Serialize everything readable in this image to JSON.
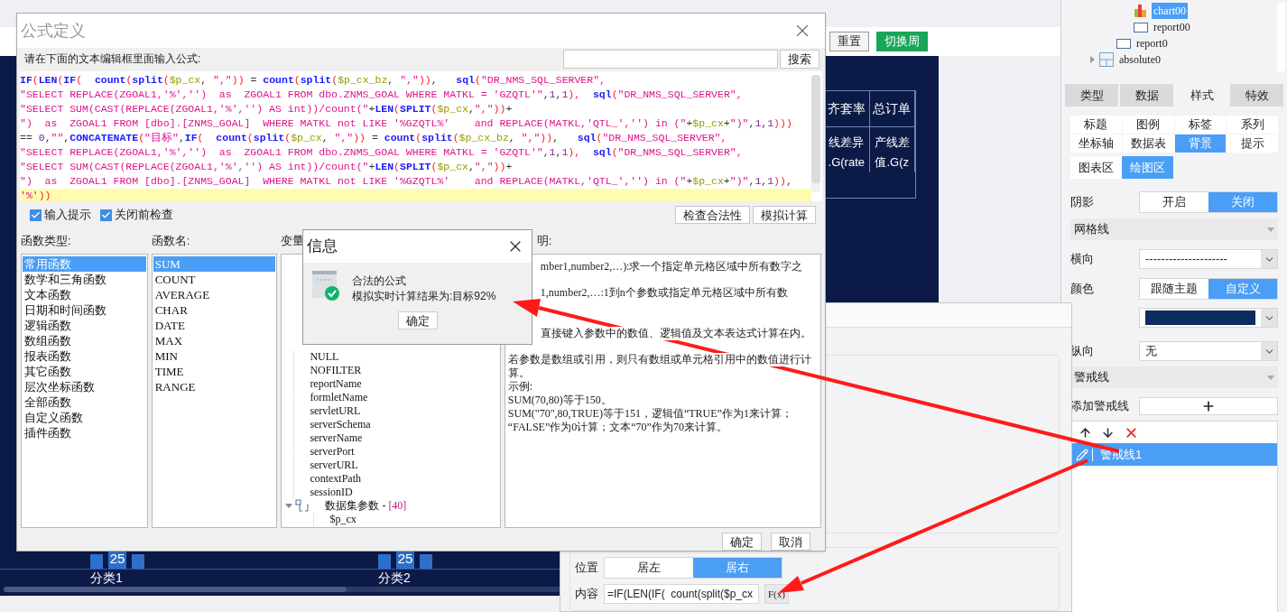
{
  "dashboard": {
    "buttons": [
      {
        "label": "重置",
        "kind": "plain"
      },
      {
        "label": "切换周",
        "kind": "primary"
      }
    ],
    "table": {
      "columns": [
        "齐套率",
        "总订单"
      ],
      "cells": [
        [
          "线差异",
          ".G(rate"
        ],
        [
          "产线差",
          "值.G(z"
        ]
      ]
    },
    "categories": [
      {
        "label": "分类1",
        "value_label": "25"
      },
      {
        "label": "分类2",
        "value_label": "25"
      }
    ]
  },
  "series_dialog": {
    "position": {
      "label": "位置",
      "options": [
        {
          "label": "居左",
          "selected": false
        },
        {
          "label": "居右",
          "selected": true
        }
      ]
    },
    "content": {
      "label": "内容",
      "value": "=IF(LEN(IF(  count(split($p_cx",
      "button": "F(x)"
    }
  },
  "right_panel": {
    "tree": [
      {
        "children": [
          {
            "children": [
              {
                "label": "chart00",
                "kind": "chart",
                "selected": true
              },
              {
                "label": "report00",
                "kind": "report",
                "selected": false
              }
            ]
          },
          {
            "label": "report0",
            "kind": "report",
            "selected": false
          }
        ]
      },
      {
        "label": "absolute0",
        "kind": "layout",
        "selected": false,
        "expanded": false
      }
    ],
    "tabs": [
      {
        "label": "类型",
        "selected": false
      },
      {
        "label": "数据",
        "selected": false
      },
      {
        "label": "样式",
        "selected": true
      },
      {
        "label": "特效",
        "selected": false
      }
    ],
    "sub_tabs": [
      {
        "label": "标题",
        "selected": false
      },
      {
        "label": "图例",
        "selected": false
      },
      {
        "label": "标签",
        "selected": false
      },
      {
        "label": "系列",
        "selected": false
      },
      {
        "label": "坐标轴",
        "selected": false
      },
      {
        "label": "数据表",
        "selected": false
      },
      {
        "label": "背景",
        "selected": true
      },
      {
        "label": "提示",
        "selected": false
      }
    ],
    "area_tabs": [
      {
        "label": "图表区",
        "selected": false
      },
      {
        "label": "绘图区",
        "selected": true
      }
    ],
    "shadow": {
      "label": "阴影",
      "options": [
        {
          "label": "开启",
          "selected": false
        },
        {
          "label": "关闭",
          "selected": true
        }
      ]
    },
    "gridlines": {
      "title": "网格线",
      "expanded": true,
      "horizontal": {
        "label": "横向",
        "value": "---------------------"
      },
      "color": {
        "label": "颜色",
        "options": [
          {
            "label": "跟随主题",
            "selected": false
          },
          {
            "label": "自定义",
            "selected": true
          }
        ]
      },
      "color_value": {
        "color": "#0b2c5f"
      },
      "vertical": {
        "label": "纵向",
        "value": "无"
      }
    },
    "alert_lines": {
      "title": "警戒线",
      "expanded": true,
      "add_label": "添加警戒线",
      "items": [
        {
          "label": "警戒线1",
          "selected": true
        }
      ]
    }
  },
  "formula_dialog": {
    "title": "公式定义",
    "prompt": "请在下面的文本编辑框里面输入公式:",
    "search_button": "搜索",
    "code_lines": [
      {
        "current": false,
        "tokens": [
          {
            "text": "IF",
            "kind": "f"
          },
          {
            "text": "(",
            "kind": "p"
          },
          {
            "text": "LEN",
            "kind": "f"
          },
          {
            "text": "(",
            "kind": "p"
          },
          {
            "text": "IF",
            "kind": "f"
          },
          {
            "text": "(  ",
            "kind": "p"
          },
          {
            "text": "count",
            "kind": "f"
          },
          {
            "text": "(",
            "kind": "p"
          },
          {
            "text": "split",
            "kind": "f"
          },
          {
            "text": "(",
            "kind": "p"
          },
          {
            "text": "$p_cx",
            "kind": "v"
          },
          {
            "text": ", ",
            "kind": "o"
          },
          {
            "text": "\",\"",
            "kind": "s"
          },
          {
            "text": "))",
            "kind": "p"
          },
          {
            "text": " = ",
            "kind": "o"
          },
          {
            "text": "count",
            "kind": "f"
          },
          {
            "text": "(",
            "kind": "p"
          },
          {
            "text": "split",
            "kind": "f"
          },
          {
            "text": "(",
            "kind": "p"
          },
          {
            "text": "$p_cx_bz",
            "kind": "v"
          },
          {
            "text": ", ",
            "kind": "o"
          },
          {
            "text": "\",\"",
            "kind": "s"
          },
          {
            "text": "))",
            "kind": "p"
          },
          {
            "text": ",   ",
            "kind": "o"
          },
          {
            "text": "sql",
            "kind": "f"
          },
          {
            "text": "(",
            "kind": "p"
          },
          {
            "text": "\"DR_NMS_SQL_SERVER\",",
            "kind": "s"
          }
        ]
      },
      {
        "current": false,
        "tokens": [
          {
            "text": "\"SELECT REPLACE(ZGOAL1,'%','')  as  ZGOAL1 FROM dbo.ZNMS_GOAL WHERE MATKL = 'GZQTL'\"",
            "kind": "s"
          },
          {
            "text": ",",
            "kind": "o"
          },
          {
            "text": "1",
            "kind": "n"
          },
          {
            "text": ",",
            "kind": "o"
          },
          {
            "text": "1",
            "kind": "n"
          },
          {
            "text": "),  ",
            "kind": "p"
          },
          {
            "text": "sql",
            "kind": "f"
          },
          {
            "text": "(",
            "kind": "p"
          },
          {
            "text": "\"DR_NMS_SQL_SERVER\",",
            "kind": "s"
          }
        ]
      },
      {
        "current": false,
        "tokens": [
          {
            "text": "\"SELECT SUM(CAST(REPLACE(ZGOAL1,'%','') AS int))/count(\"",
            "kind": "s"
          },
          {
            "text": "+",
            "kind": "o"
          },
          {
            "text": "LEN",
            "kind": "f"
          },
          {
            "text": "(",
            "kind": "p"
          },
          {
            "text": "SPLIT",
            "kind": "f"
          },
          {
            "text": "(",
            "kind": "p"
          },
          {
            "text": "$p_cx",
            "kind": "v"
          },
          {
            "text": ",",
            "kind": "o"
          },
          {
            "text": "\",\"",
            "kind": "s"
          },
          {
            "text": "))",
            "kind": "p"
          },
          {
            "text": "+",
            "kind": "o"
          }
        ]
      },
      {
        "current": false,
        "tokens": [
          {
            "text": "\")  as  ZGOAL1 FROM [dbo].[ZNMS_GOAL]  WHERE MATKL not LIKE '%GZQTL%'    and REPLACE(MATKL,'QTL_','') in (\"",
            "kind": "s"
          },
          {
            "text": "+",
            "kind": "o"
          },
          {
            "text": "$p_cx",
            "kind": "v"
          },
          {
            "text": "+",
            "kind": "o"
          },
          {
            "text": "\")\"",
            "kind": "s"
          },
          {
            "text": ",",
            "kind": "o"
          },
          {
            "text": "1",
            "kind": "n"
          },
          {
            "text": ",",
            "kind": "o"
          },
          {
            "text": "1",
            "kind": "n"
          },
          {
            "text": ")))",
            "kind": "p"
          }
        ]
      },
      {
        "current": false,
        "tokens": [
          {
            "text": "== ",
            "kind": "o"
          },
          {
            "text": "0",
            "kind": "n"
          },
          {
            "text": ",",
            "kind": "o"
          },
          {
            "text": "\"\"",
            "kind": "s"
          },
          {
            "text": ",",
            "kind": "o"
          },
          {
            "text": "CONCATENATE",
            "kind": "f"
          },
          {
            "text": "(",
            "kind": "p"
          },
          {
            "text": "\"目标\"",
            "kind": "s"
          },
          {
            "text": ",",
            "kind": "o"
          },
          {
            "text": "IF",
            "kind": "f"
          },
          {
            "text": "(  ",
            "kind": "p"
          },
          {
            "text": "count",
            "kind": "f"
          },
          {
            "text": "(",
            "kind": "p"
          },
          {
            "text": "split",
            "kind": "f"
          },
          {
            "text": "(",
            "kind": "p"
          },
          {
            "text": "$p_cx",
            "kind": "v"
          },
          {
            "text": ", ",
            "kind": "o"
          },
          {
            "text": "\",\"",
            "kind": "s"
          },
          {
            "text": "))",
            "kind": "p"
          },
          {
            "text": " = ",
            "kind": "o"
          },
          {
            "text": "count",
            "kind": "f"
          },
          {
            "text": "(",
            "kind": "p"
          },
          {
            "text": "split",
            "kind": "f"
          },
          {
            "text": "(",
            "kind": "p"
          },
          {
            "text": "$p_cx_bz",
            "kind": "v"
          },
          {
            "text": ", ",
            "kind": "o"
          },
          {
            "text": "\",\"",
            "kind": "s"
          },
          {
            "text": "))",
            "kind": "p"
          },
          {
            "text": ",   ",
            "kind": "o"
          },
          {
            "text": "sql",
            "kind": "f"
          },
          {
            "text": "(",
            "kind": "p"
          },
          {
            "text": "\"DR_NMS_SQL_SERVER\",",
            "kind": "s"
          }
        ]
      },
      {
        "current": false,
        "tokens": [
          {
            "text": "\"SELECT REPLACE(ZGOAL1,'%','')  as  ZGOAL1 FROM dbo.ZNMS_GOAL WHERE MATKL = 'GZQTL'\"",
            "kind": "s"
          },
          {
            "text": ",",
            "kind": "o"
          },
          {
            "text": "1",
            "kind": "n"
          },
          {
            "text": ",",
            "kind": "o"
          },
          {
            "text": "1",
            "kind": "n"
          },
          {
            "text": "),  ",
            "kind": "p"
          },
          {
            "text": "sql",
            "kind": "f"
          },
          {
            "text": "(",
            "kind": "p"
          },
          {
            "text": "\"DR_NMS_SQL_SERVER\",",
            "kind": "s"
          }
        ]
      },
      {
        "current": false,
        "tokens": [
          {
            "text": "\"SELECT SUM(CAST(REPLACE(ZGOAL1,'%','') AS int))/count(\"",
            "kind": "s"
          },
          {
            "text": "+",
            "kind": "o"
          },
          {
            "text": "LEN",
            "kind": "f"
          },
          {
            "text": "(",
            "kind": "p"
          },
          {
            "text": "SPLIT",
            "kind": "f"
          },
          {
            "text": "(",
            "kind": "p"
          },
          {
            "text": "$p_cx",
            "kind": "v"
          },
          {
            "text": ",",
            "kind": "o"
          },
          {
            "text": "\",\"",
            "kind": "s"
          },
          {
            "text": "))",
            "kind": "p"
          },
          {
            "text": "+",
            "kind": "o"
          }
        ]
      },
      {
        "current": false,
        "tokens": [
          {
            "text": "\")  as  ZGOAL1 FROM [dbo].[ZNMS_GOAL]  WHERE MATKL not LIKE '%GZQTL%'    and REPLACE(MATKL,'QTL_','') in (\"",
            "kind": "s"
          },
          {
            "text": "+",
            "kind": "o"
          },
          {
            "text": "$p_cx",
            "kind": "v"
          },
          {
            "text": "+",
            "kind": "o"
          },
          {
            "text": "\")\"",
            "kind": "s"
          },
          {
            "text": ",",
            "kind": "o"
          },
          {
            "text": "1",
            "kind": "n"
          },
          {
            "text": ",",
            "kind": "o"
          },
          {
            "text": "1",
            "kind": "n"
          },
          {
            "text": "))",
            "kind": "p"
          },
          {
            "text": ",",
            "kind": "o"
          }
        ]
      },
      {
        "current": true,
        "tokens": [
          {
            "text": "'%'",
            "kind": "s"
          },
          {
            "text": "))",
            "kind": "p"
          }
        ]
      }
    ],
    "options": [
      {
        "label": "输入提示",
        "checked": true
      },
      {
        "label": "关闭前检查",
        "checked": true
      }
    ],
    "action_buttons": [
      "检查合法性",
      "模拟计算"
    ],
    "function_types": {
      "heading": "函数类型:",
      "items": [
        {
          "label": "常用函数",
          "selected": true
        },
        {
          "label": "数学和三角函数",
          "selected": false
        },
        {
          "label": "文本函数",
          "selected": false
        },
        {
          "label": "日期和时间函数",
          "selected": false
        },
        {
          "label": "逻辑函数",
          "selected": false
        },
        {
          "label": "数组函数",
          "selected": false
        },
        {
          "label": "报表函数",
          "selected": false
        },
        {
          "label": "其它函数",
          "selected": false
        },
        {
          "label": "层次坐标函数",
          "selected": false
        },
        {
          "label": "全部函数",
          "selected": false
        },
        {
          "label": "自定义函数",
          "selected": false
        },
        {
          "label": "插件函数",
          "selected": false
        }
      ]
    },
    "function_names": {
      "heading": "函数名:",
      "items": [
        {
          "label": "SUM",
          "selected": true
        },
        {
          "label": "COUNT",
          "selected": false
        },
        {
          "label": "AVERAGE",
          "selected": false
        },
        {
          "label": "CHAR",
          "selected": false
        },
        {
          "label": "DATE",
          "selected": false
        },
        {
          "label": "MAX",
          "selected": false
        },
        {
          "label": "MIN",
          "selected": false
        },
        {
          "label": "TIME",
          "selected": false
        },
        {
          "label": "RANGE",
          "selected": false
        }
      ]
    },
    "variables": {
      "heading": "变量",
      "tree": [
        {
          "label": "NULL"
        },
        {
          "label": "NOFILTER"
        },
        {
          "label": "reportName"
        },
        {
          "label": "formletName"
        },
        {
          "label": "servletURL"
        },
        {
          "label": "serverSchema"
        },
        {
          "label": "serverName"
        },
        {
          "label": "serverPort"
        },
        {
          "label": "serverURL"
        },
        {
          "label": "contextPath"
        },
        {
          "label": "sessionID"
        },
        {
          "label": "数据集参数 - ",
          "count": "[40]",
          "expanded": true,
          "children": [
            {
              "label": "$p_cx"
            }
          ]
        }
      ]
    },
    "description": {
      "heading": "明:",
      "covered_lines": [
        "mber1,number2,…):求一个指定单元格区域中所有数字之",
        "1,number2,…:1到n个参数或指定单元格区域中所有数",
        "直接键入参数中的数值、逻辑值及文本表达式计算在内。"
      ],
      "lines": [
        "若参数是数组或引用，则只有数组或单元格引用中的数值进行计",
        "算。",
        "示例:",
        "SUM(70,80)等于150。",
        "SUM(\"70\",80,TRUE)等于151，逻辑值“TRUE”作为1来计算；",
        "“FALSE”作为0计算；文本“70”作为70来计算。"
      ]
    },
    "buttons": [
      "确定",
      "取消"
    ]
  },
  "info_dialog": {
    "title": "信息",
    "message": "合法的公式",
    "result": "模拟实时计算结果为:目标92%",
    "button": "确定"
  }
}
